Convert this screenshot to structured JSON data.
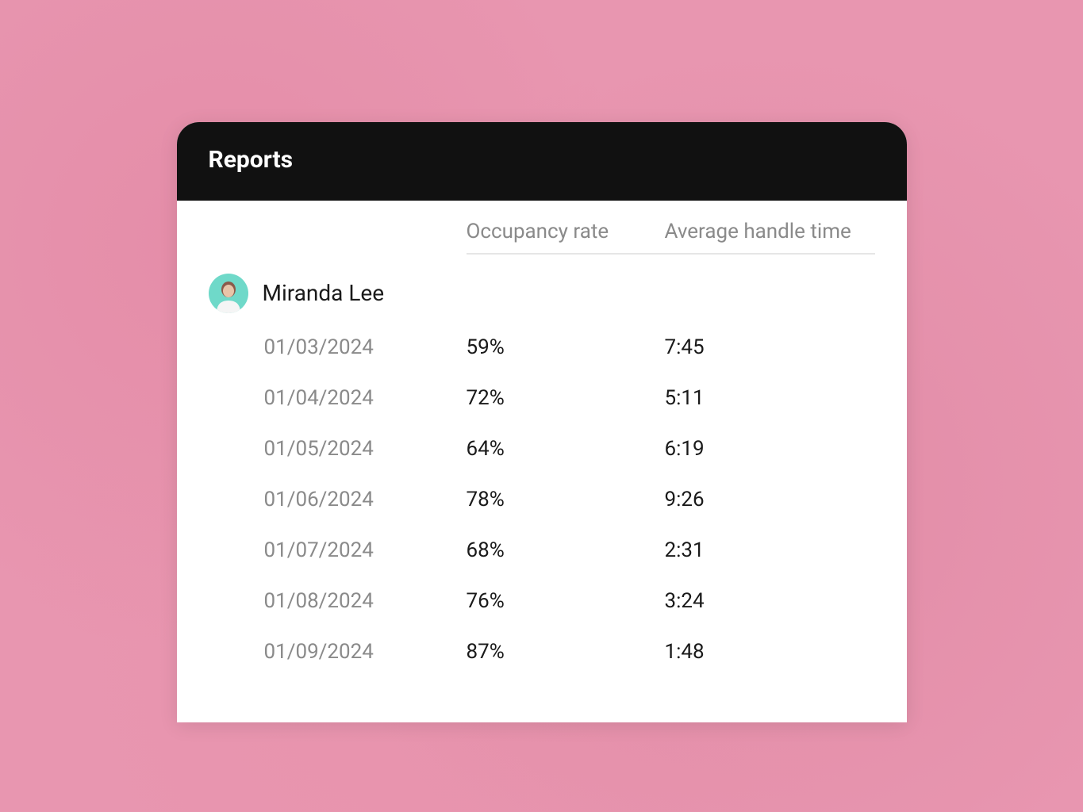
{
  "header": {
    "title": "Reports"
  },
  "columns": {
    "occupancy": "Occupancy rate",
    "aht": "Average handle time"
  },
  "agent": {
    "name": "Miranda Lee",
    "avatar_bg": "#6fd9c9"
  },
  "rows": [
    {
      "date": "01/03/2024",
      "occupancy": "59%",
      "aht": "7:45"
    },
    {
      "date": "01/04/2024",
      "occupancy": "72%",
      "aht": "5:11"
    },
    {
      "date": "01/05/2024",
      "occupancy": "64%",
      "aht": "6:19"
    },
    {
      "date": "01/06/2024",
      "occupancy": "78%",
      "aht": "9:26"
    },
    {
      "date": "01/07/2024",
      "occupancy": "68%",
      "aht": "2:31"
    },
    {
      "date": "01/08/2024",
      "occupancy": "76%",
      "aht": "3:24"
    },
    {
      "date": "01/09/2024",
      "occupancy": "87%",
      "aht": "1:48"
    }
  ]
}
